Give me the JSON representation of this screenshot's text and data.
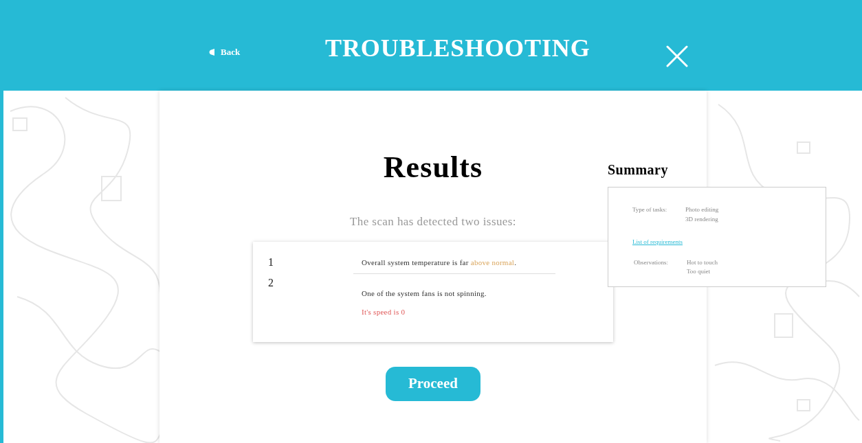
{
  "header": {
    "back": "Back",
    "title": "TROUBLESHOOTING"
  },
  "results": {
    "title": "Results",
    "subtitle": "The scan has detected two issues:",
    "issues": [
      {
        "number": "1",
        "parts": [
          {
            "text": "Overall system temperature is far ",
            "kind": "plain"
          },
          {
            "text": "above normal",
            "kind": "warning"
          },
          {
            "text": ".",
            "kind": "plain"
          }
        ]
      },
      {
        "number": "2",
        "parts": [
          {
            "text": "One of the system fans is not spinning.",
            "kind": "plain"
          }
        ],
        "detail": "It's speed is 0"
      }
    ],
    "button": "Proceed"
  },
  "summary": {
    "title": "Summary",
    "tasks_label": "Type of tasks:",
    "tasks": [
      "Photo editing",
      "3D rendering"
    ],
    "link": "List of requirements",
    "observations_label": "Observations:",
    "observations": [
      "Hot to touch",
      "Too quiet"
    ]
  }
}
